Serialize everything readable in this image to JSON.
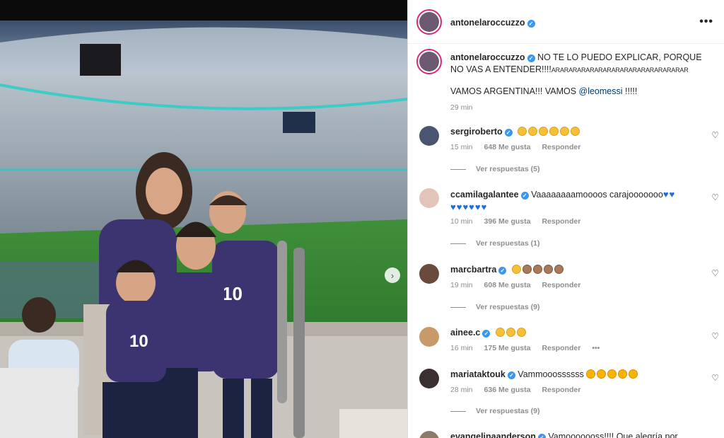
{
  "post": {
    "username": "antonelaroccuzzo",
    "more_label": "•••",
    "next_label": "›",
    "caption_text": "NO TE LO PUEDO EXPLICAR, PORQUE NO VAS A ENTENDER!!!!",
    "caption_tail": "ARARARARARARARARARARARARARARARAR",
    "caption_line2_pre": "VAMOS ARGENTINA!!! VAMOS ",
    "caption_mention": "@leomessi",
    "caption_line2_post": " !!!!!",
    "time": "29 min"
  },
  "comments": [
    {
      "username": "sergiroberto",
      "text": "",
      "emoji": [
        "clap",
        "clap",
        "clap",
        "clap",
        "clap",
        "clap"
      ],
      "time": "15 min",
      "likes": "648 Me gusta",
      "reply": "Responder",
      "replies": "Ver respuestas (5)",
      "avatar_color": "#4a5570"
    },
    {
      "username": "ccamilagalantee",
      "text": "Vaaaaaaaamoooos carajooooooo",
      "emoji_after": [
        "heart-blue",
        "heart-blue"
      ],
      "emoji_line2": [
        "heart-blue",
        "heart-blue",
        "heart-blue",
        "heart-blue",
        "heart-blue",
        "heart-blue"
      ],
      "time": "10 min",
      "likes": "396 Me gusta",
      "reply": "Responder",
      "replies": "Ver respuestas (1)",
      "avatar_color": "#e3c4b8"
    },
    {
      "username": "marcbartra",
      "text": "",
      "emoji": [
        "clap",
        "clap-dark",
        "clap-dark",
        "clap-dark",
        "clap-dark"
      ],
      "time": "19 min",
      "likes": "608 Me gusta",
      "reply": "Responder",
      "replies": "Ver respuestas (9)",
      "avatar_color": "#6a4a3c"
    },
    {
      "username": "ainee.c",
      "text": "",
      "emoji": [
        "clap",
        "clap",
        "clap"
      ],
      "time": "16 min",
      "likes": "175 Me gusta",
      "reply": "Responder",
      "more": "•••",
      "avatar_color": "#c89a6a"
    },
    {
      "username": "mariataktouk",
      "text": "Vammooossssss",
      "emoji_after": [
        "star-eyes",
        "star-eyes",
        "star-eyes",
        "star-eyes",
        "star-eyes"
      ],
      "time": "28 min",
      "likes": "636 Me gusta",
      "reply": "Responder",
      "replies": "Ver respuestas (9)",
      "avatar_color": "#3a3030"
    },
    {
      "username": "evangelinaanderson",
      "text": "Vamooooooss!!!! Que alegría por",
      "avatar_color": "#8a7a6a"
    }
  ],
  "icons": {
    "verified": "verified-badge-icon",
    "like": "heart-outline-icon",
    "more": "more-horizontal-icon",
    "next": "chevron-right-icon"
  },
  "colors": {
    "accent_verified": "#3897f0",
    "mention": "#00376b",
    "meta_gray": "#8e8e8e"
  }
}
